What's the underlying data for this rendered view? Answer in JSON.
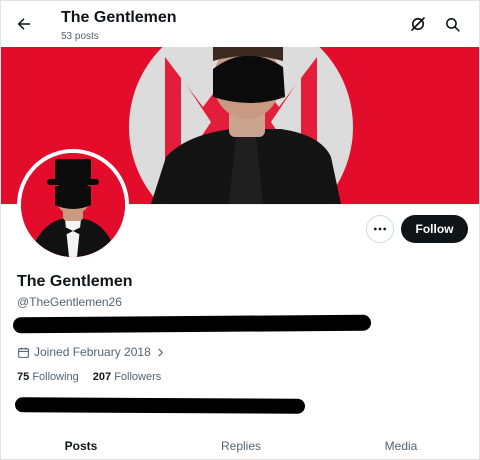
{
  "header": {
    "title": "The Gentlemen",
    "posts_count": "53 posts",
    "icons": [
      "back-arrow-icon",
      "grok-icon",
      "search-icon"
    ]
  },
  "profile": {
    "display_name": "The Gentlemen",
    "handle": "@TheGentlemen26",
    "joined": "Joined February 2018",
    "following_count": "75",
    "following_label": "Following",
    "followers_count": "207",
    "followers_label": "Followers"
  },
  "actions": {
    "follow_label": "Follow",
    "more_icon": "more-horizontal-icon"
  },
  "tabs": [
    {
      "label": "Posts",
      "active": true
    },
    {
      "label": "Replies",
      "active": false
    },
    {
      "label": "Media",
      "active": false
    }
  ],
  "colors": {
    "banner_red": "#e30d2b",
    "text_primary": "#0f1419",
    "text_secondary": "#536471",
    "follow_button": "#0f1419"
  }
}
